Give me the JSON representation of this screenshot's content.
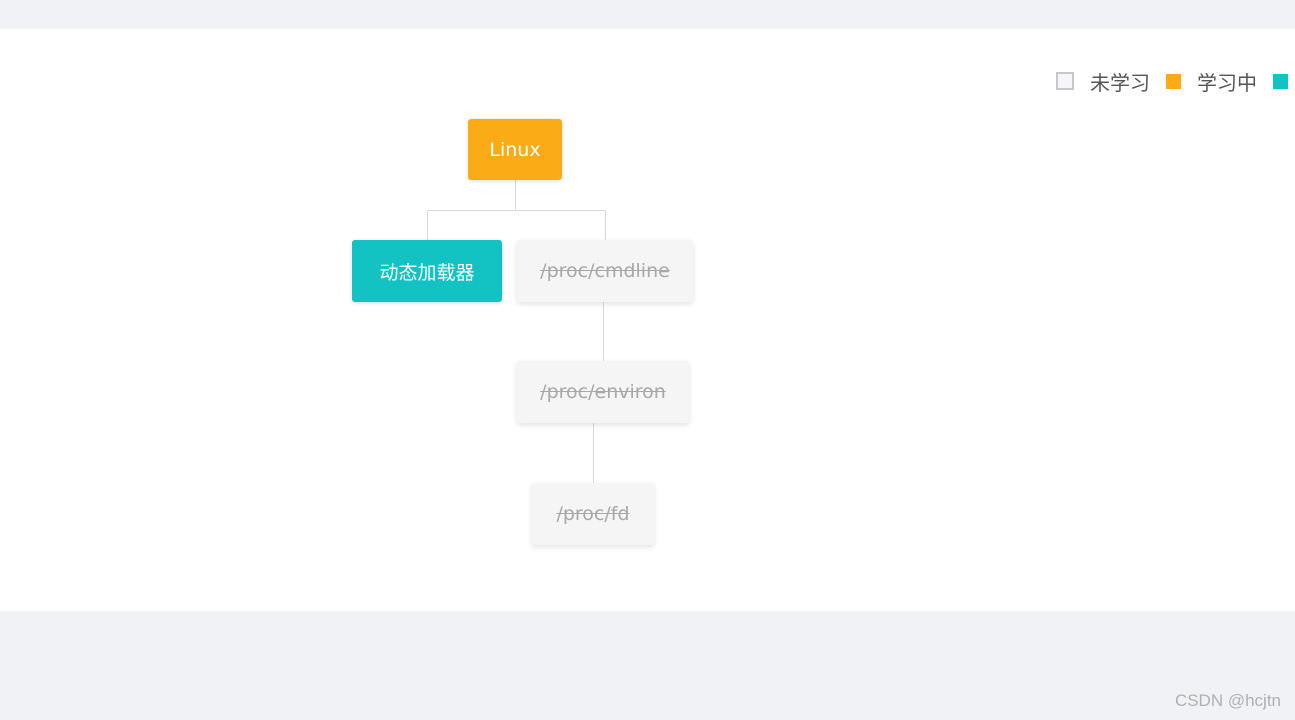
{
  "legend": {
    "items": [
      {
        "label": "未学习",
        "color": "#f6f6f8"
      },
      {
        "label": "学习中",
        "color": "#fbab16"
      },
      {
        "label": "",
        "color": "#13c2c2"
      }
    ]
  },
  "tree": {
    "root": {
      "label": "Linux",
      "status": "learning"
    },
    "child_a": {
      "label": "动态加载器",
      "status": "done"
    },
    "child_b": {
      "label": "/proc/cmdline",
      "status": "unlearned"
    },
    "child_b1": {
      "label": "/proc/environ",
      "status": "unlearned"
    },
    "child_b2": {
      "label": "/proc/fd",
      "status": "unlearned"
    }
  },
  "watermark": "CSDN @hcjtn"
}
